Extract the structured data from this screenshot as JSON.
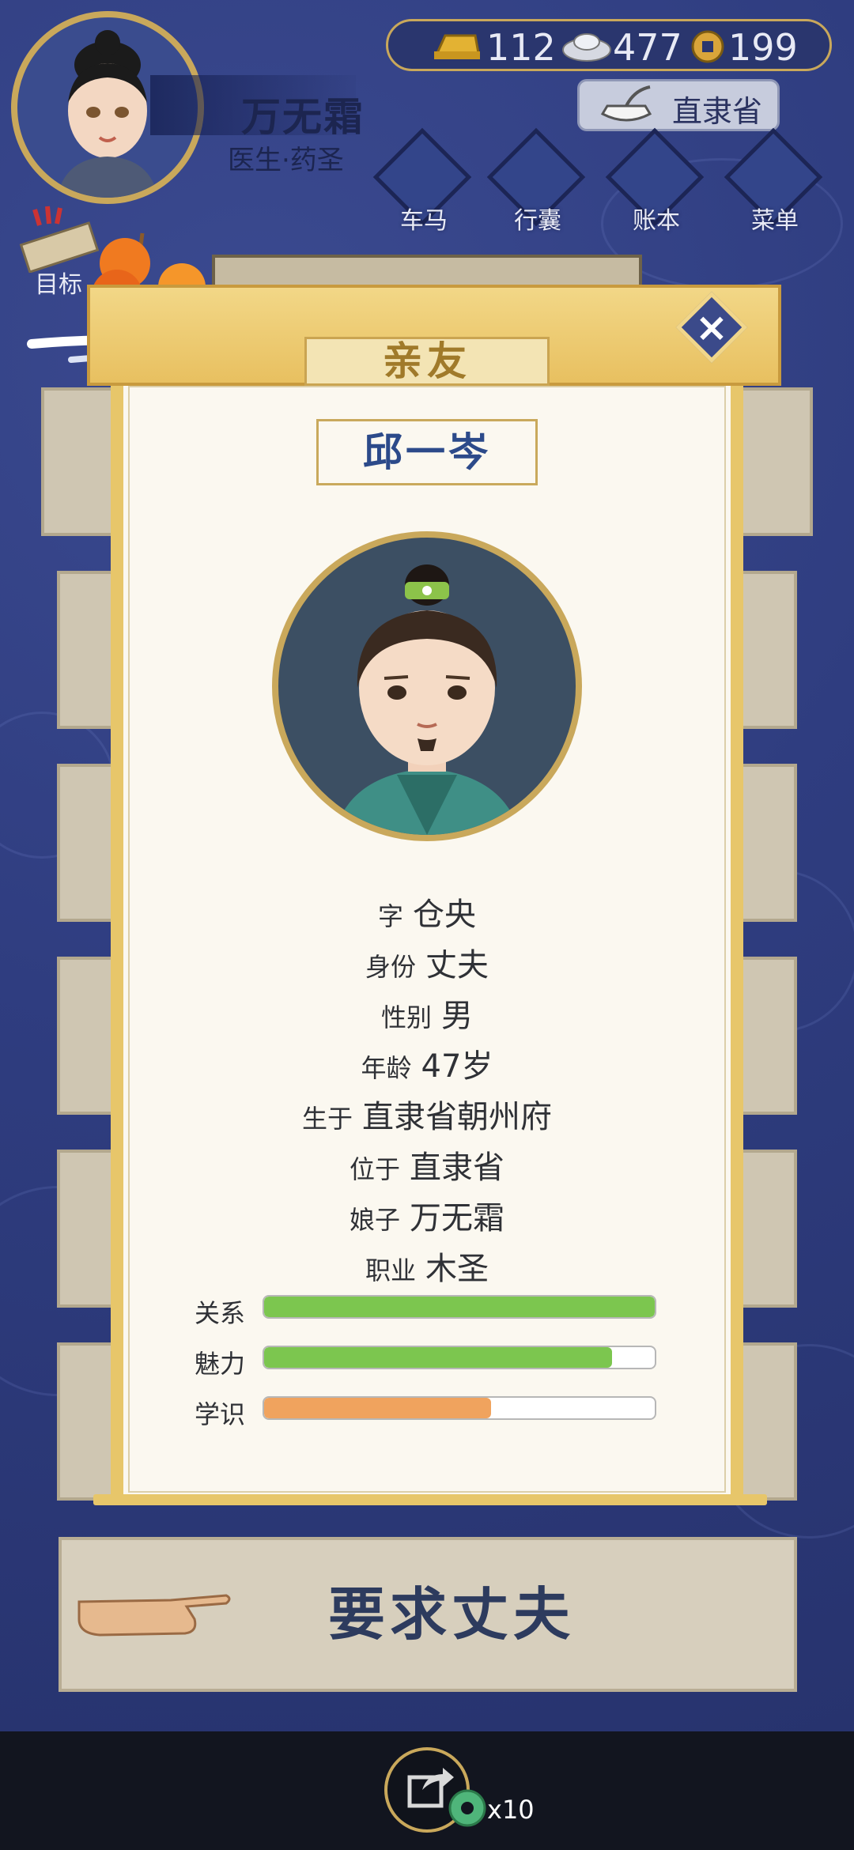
{
  "header": {
    "player_name": "万无霜",
    "player_title": "医生·药圣",
    "currency": {
      "gold": "112",
      "silver": "477",
      "coin": "199"
    },
    "region": "直隶省",
    "nav": [
      {
        "label": "车马",
        "icon": "cart-icon"
      },
      {
        "label": "行囊",
        "icon": "bag-icon"
      },
      {
        "label": "账本",
        "icon": "ledger-icon"
      },
      {
        "label": "菜单",
        "icon": "menu-icon"
      }
    ],
    "goal_label": "目标"
  },
  "background": {
    "panel_title": "亲友"
  },
  "panel": {
    "title": "亲友",
    "name": "邱一岑",
    "info": [
      {
        "key": "字",
        "value": "仓央"
      },
      {
        "key": "身份",
        "value": "丈夫"
      },
      {
        "key": "性别",
        "value": "男"
      },
      {
        "key": "年龄",
        "value": "47岁"
      },
      {
        "key": "生于",
        "value": "直隶省朝州府"
      },
      {
        "key": "位于",
        "value": "直隶省"
      },
      {
        "key": "娘子",
        "value": "万无霜"
      },
      {
        "key": "职业",
        "value": "木圣"
      }
    ],
    "stats": [
      {
        "label": "关系",
        "fraction": 1.0,
        "color": "#7cc64f"
      },
      {
        "label": "魅力",
        "fraction": 0.89,
        "color": "#7cc64f"
      },
      {
        "label": "学识",
        "fraction": 0.58,
        "color": "#f0a35e"
      }
    ]
  },
  "action": {
    "label": "要求丈夫"
  },
  "footer": {
    "share_count": "x10"
  }
}
